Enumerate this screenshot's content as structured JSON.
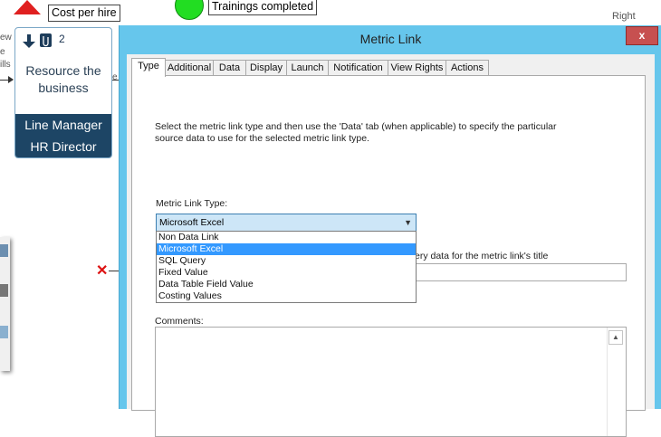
{
  "background": {
    "cost_per_hire": "Cost per hire",
    "trainings_completed": "Trainings completed",
    "right_text": "Right",
    "left_fragments": [
      "ew",
      "e",
      "ills"
    ],
    "process": {
      "number": "2",
      "title": "Resource the business",
      "roles": [
        "Line Manager",
        "HR Director"
      ],
      "side_letter": "e"
    }
  },
  "dialog": {
    "title": "Metric Link",
    "close_label": "x",
    "tabs": [
      "Type",
      "Additional",
      "Data",
      "Display",
      "Launch",
      "Notification",
      "View Rights",
      "Actions"
    ],
    "active_tab": "Type",
    "description": "Select the metric link type and then use the 'Data' tab (when applicable) to specify the particular source data to use for the selected metric link type.",
    "metric_link_type_label": "Metric Link Type:",
    "metric_link_type_value": "Microsoft Excel",
    "options": [
      "Non Data Link",
      "Microsoft Excel",
      "SQL Query",
      "Fixed Value",
      "Data Table Field Value",
      "Costing Values"
    ],
    "selected_option": "Microsoft Excel",
    "title_query_label_partial": "ery data for the metric link's title",
    "title_query_value": "",
    "comments_label": "Comments:",
    "comments_value": ""
  }
}
